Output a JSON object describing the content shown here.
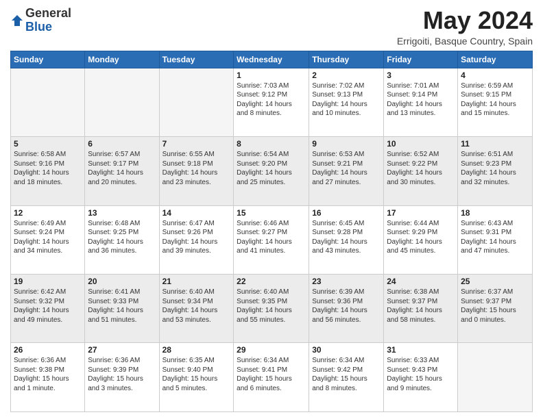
{
  "logo": {
    "general": "General",
    "blue": "Blue"
  },
  "title": "May 2024",
  "location": "Errigoiti, Basque Country, Spain",
  "weekdays": [
    "Sunday",
    "Monday",
    "Tuesday",
    "Wednesday",
    "Thursday",
    "Friday",
    "Saturday"
  ],
  "weeks": [
    [
      {
        "day": "",
        "info": ""
      },
      {
        "day": "",
        "info": ""
      },
      {
        "day": "",
        "info": ""
      },
      {
        "day": "1",
        "info": "Sunrise: 7:03 AM\nSunset: 9:12 PM\nDaylight: 14 hours\nand 8 minutes."
      },
      {
        "day": "2",
        "info": "Sunrise: 7:02 AM\nSunset: 9:13 PM\nDaylight: 14 hours\nand 10 minutes."
      },
      {
        "day": "3",
        "info": "Sunrise: 7:01 AM\nSunset: 9:14 PM\nDaylight: 14 hours\nand 13 minutes."
      },
      {
        "day": "4",
        "info": "Sunrise: 6:59 AM\nSunset: 9:15 PM\nDaylight: 14 hours\nand 15 minutes."
      }
    ],
    [
      {
        "day": "5",
        "info": "Sunrise: 6:58 AM\nSunset: 9:16 PM\nDaylight: 14 hours\nand 18 minutes."
      },
      {
        "day": "6",
        "info": "Sunrise: 6:57 AM\nSunset: 9:17 PM\nDaylight: 14 hours\nand 20 minutes."
      },
      {
        "day": "7",
        "info": "Sunrise: 6:55 AM\nSunset: 9:18 PM\nDaylight: 14 hours\nand 23 minutes."
      },
      {
        "day": "8",
        "info": "Sunrise: 6:54 AM\nSunset: 9:20 PM\nDaylight: 14 hours\nand 25 minutes."
      },
      {
        "day": "9",
        "info": "Sunrise: 6:53 AM\nSunset: 9:21 PM\nDaylight: 14 hours\nand 27 minutes."
      },
      {
        "day": "10",
        "info": "Sunrise: 6:52 AM\nSunset: 9:22 PM\nDaylight: 14 hours\nand 30 minutes."
      },
      {
        "day": "11",
        "info": "Sunrise: 6:51 AM\nSunset: 9:23 PM\nDaylight: 14 hours\nand 32 minutes."
      }
    ],
    [
      {
        "day": "12",
        "info": "Sunrise: 6:49 AM\nSunset: 9:24 PM\nDaylight: 14 hours\nand 34 minutes."
      },
      {
        "day": "13",
        "info": "Sunrise: 6:48 AM\nSunset: 9:25 PM\nDaylight: 14 hours\nand 36 minutes."
      },
      {
        "day": "14",
        "info": "Sunrise: 6:47 AM\nSunset: 9:26 PM\nDaylight: 14 hours\nand 39 minutes."
      },
      {
        "day": "15",
        "info": "Sunrise: 6:46 AM\nSunset: 9:27 PM\nDaylight: 14 hours\nand 41 minutes."
      },
      {
        "day": "16",
        "info": "Sunrise: 6:45 AM\nSunset: 9:28 PM\nDaylight: 14 hours\nand 43 minutes."
      },
      {
        "day": "17",
        "info": "Sunrise: 6:44 AM\nSunset: 9:29 PM\nDaylight: 14 hours\nand 45 minutes."
      },
      {
        "day": "18",
        "info": "Sunrise: 6:43 AM\nSunset: 9:31 PM\nDaylight: 14 hours\nand 47 minutes."
      }
    ],
    [
      {
        "day": "19",
        "info": "Sunrise: 6:42 AM\nSunset: 9:32 PM\nDaylight: 14 hours\nand 49 minutes."
      },
      {
        "day": "20",
        "info": "Sunrise: 6:41 AM\nSunset: 9:33 PM\nDaylight: 14 hours\nand 51 minutes."
      },
      {
        "day": "21",
        "info": "Sunrise: 6:40 AM\nSunset: 9:34 PM\nDaylight: 14 hours\nand 53 minutes."
      },
      {
        "day": "22",
        "info": "Sunrise: 6:40 AM\nSunset: 9:35 PM\nDaylight: 14 hours\nand 55 minutes."
      },
      {
        "day": "23",
        "info": "Sunrise: 6:39 AM\nSunset: 9:36 PM\nDaylight: 14 hours\nand 56 minutes."
      },
      {
        "day": "24",
        "info": "Sunrise: 6:38 AM\nSunset: 9:37 PM\nDaylight: 14 hours\nand 58 minutes."
      },
      {
        "day": "25",
        "info": "Sunrise: 6:37 AM\nSunset: 9:37 PM\nDaylight: 15 hours\nand 0 minutes."
      }
    ],
    [
      {
        "day": "26",
        "info": "Sunrise: 6:36 AM\nSunset: 9:38 PM\nDaylight: 15 hours\nand 1 minute."
      },
      {
        "day": "27",
        "info": "Sunrise: 6:36 AM\nSunset: 9:39 PM\nDaylight: 15 hours\nand 3 minutes."
      },
      {
        "day": "28",
        "info": "Sunrise: 6:35 AM\nSunset: 9:40 PM\nDaylight: 15 hours\nand 5 minutes."
      },
      {
        "day": "29",
        "info": "Sunrise: 6:34 AM\nSunset: 9:41 PM\nDaylight: 15 hours\nand 6 minutes."
      },
      {
        "day": "30",
        "info": "Sunrise: 6:34 AM\nSunset: 9:42 PM\nDaylight: 15 hours\nand 8 minutes."
      },
      {
        "day": "31",
        "info": "Sunrise: 6:33 AM\nSunset: 9:43 PM\nDaylight: 15 hours\nand 9 minutes."
      },
      {
        "day": "",
        "info": ""
      }
    ]
  ]
}
